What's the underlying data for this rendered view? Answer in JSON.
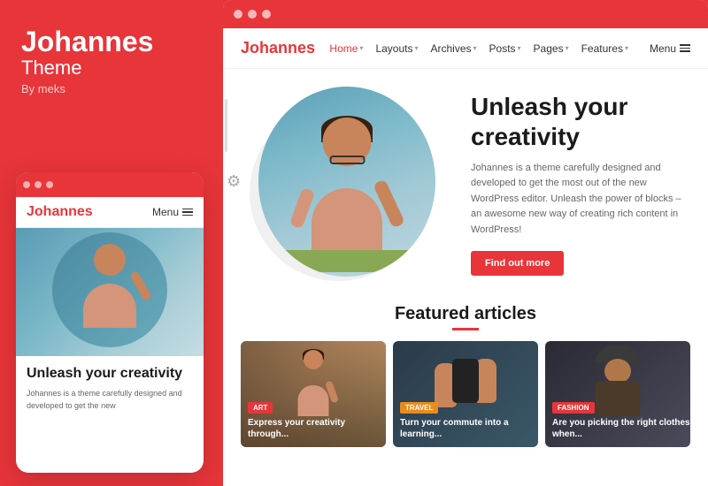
{
  "left": {
    "brand": {
      "title": "Johannes",
      "subtitle": "Theme",
      "by": "By meks"
    },
    "mobile": {
      "dots": [
        "dot1",
        "dot2",
        "dot3"
      ],
      "logo": "Johannes",
      "menu_label": "Menu",
      "hero_title": "Unleash your creativity",
      "hero_desc": "Johannes is a theme carefully designed and developed to get the new"
    }
  },
  "right": {
    "browser_dots": [
      "dot1",
      "dot2",
      "dot3"
    ],
    "nav": {
      "logo": "Johannes",
      "links": [
        {
          "label": "Home",
          "active": true,
          "has_chevron": true
        },
        {
          "label": "Layouts",
          "has_chevron": true
        },
        {
          "label": "Archives",
          "has_chevron": true
        },
        {
          "label": "Posts",
          "has_chevron": true
        },
        {
          "label": "Pages",
          "has_chevron": true
        },
        {
          "label": "Features",
          "has_chevron": true
        },
        {
          "label": "Menu"
        }
      ]
    },
    "hero": {
      "title": "Unleash your creativity",
      "description": "Johannes is a theme carefully designed and developed to get the most out of the new WordPress editor. Unleash the power of blocks – an awesome new way of creating rich content in WordPress!",
      "cta_label": "Find out more"
    },
    "featured": {
      "section_title": "Featured articles",
      "articles": [
        {
          "badge": "Art",
          "badge_type": "art",
          "title": "Express your creativity through..."
        },
        {
          "badge": "Travel",
          "badge_type": "travel",
          "title": "Turn your commute into a learning..."
        },
        {
          "badge": "Fashion",
          "badge_type": "fashion",
          "title": "Are you picking the right clothes when..."
        }
      ]
    }
  }
}
